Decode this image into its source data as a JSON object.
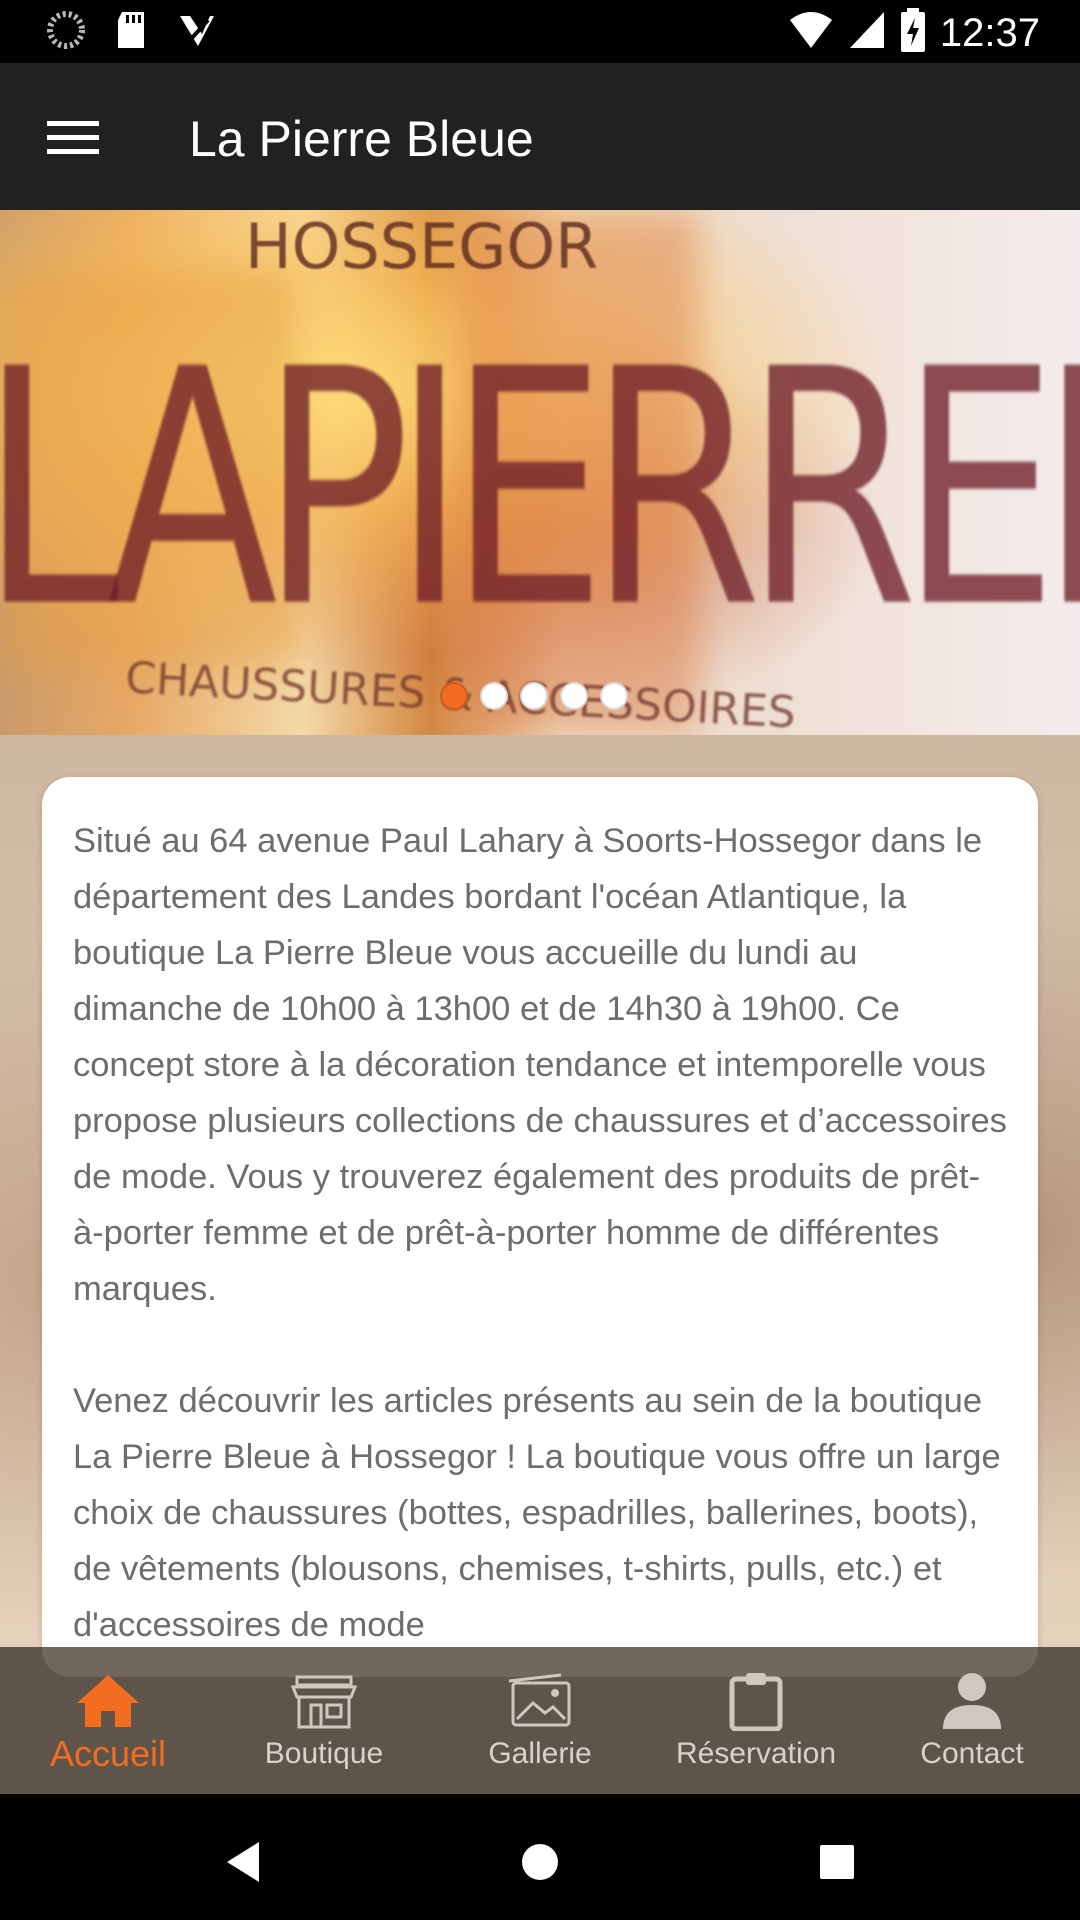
{
  "status_bar": {
    "time": "12:37",
    "icons": [
      "spinner-icon",
      "sd-card-icon",
      "download-check-icon",
      "wifi-icon",
      "signal-icon",
      "battery-charging-icon"
    ]
  },
  "app_bar": {
    "title": "La Pierre Bleue",
    "menu_icon": "hamburger-menu-icon"
  },
  "hero": {
    "brand_text": "LAPIERREBLEUE",
    "top_text": "HOSSEGOR",
    "bottom_text": "CHAUSSURES & ACCESSOIRES",
    "slides_count": 5,
    "active_slide": 1,
    "active_color": "#f26d1f"
  },
  "content": {
    "paragraph_1": "Situé au 64 avenue Paul Lahary à Soorts-Hossegor dans le département des Landes bordant l'océan Atlantique, la boutique La Pierre Bleue vous accueille du lundi au dimanche de 10h00 à 13h00 et de 14h30 à 19h00. Ce concept store à la décoration tendance et intemporelle vous propose plusieurs collections de chaussures et d’accessoires de mode. Vous y trouverez également des produits de prêt-à-porter femme et de prêt-à-porter homme de différentes marques.",
    "paragraph_2": "Venez découvrir les articles présents au sein de la boutique La Pierre Bleue à Hossegor ! La boutique vous offre un large choix de chaussures (bottes, espadrilles, ballerines, boots), de vêtements (blousons, chemises, t-shirts, pulls, etc.) et d'accessoires de mode"
  },
  "bottom_nav": {
    "items": [
      {
        "label": "Accueil",
        "icon": "home-icon",
        "active": true
      },
      {
        "label": "Boutique",
        "icon": "store-icon",
        "active": false
      },
      {
        "label": "Gallerie",
        "icon": "gallery-icon",
        "active": false
      },
      {
        "label": "Réservation",
        "icon": "clipboard-icon",
        "active": false
      },
      {
        "label": "Contact",
        "icon": "person-icon",
        "active": false
      }
    ],
    "active_color": "#f26d1f",
    "inactive_color": "#d8d2cc"
  },
  "system_nav": {
    "buttons": [
      "back-icon",
      "home-circle-icon",
      "recents-icon"
    ]
  }
}
